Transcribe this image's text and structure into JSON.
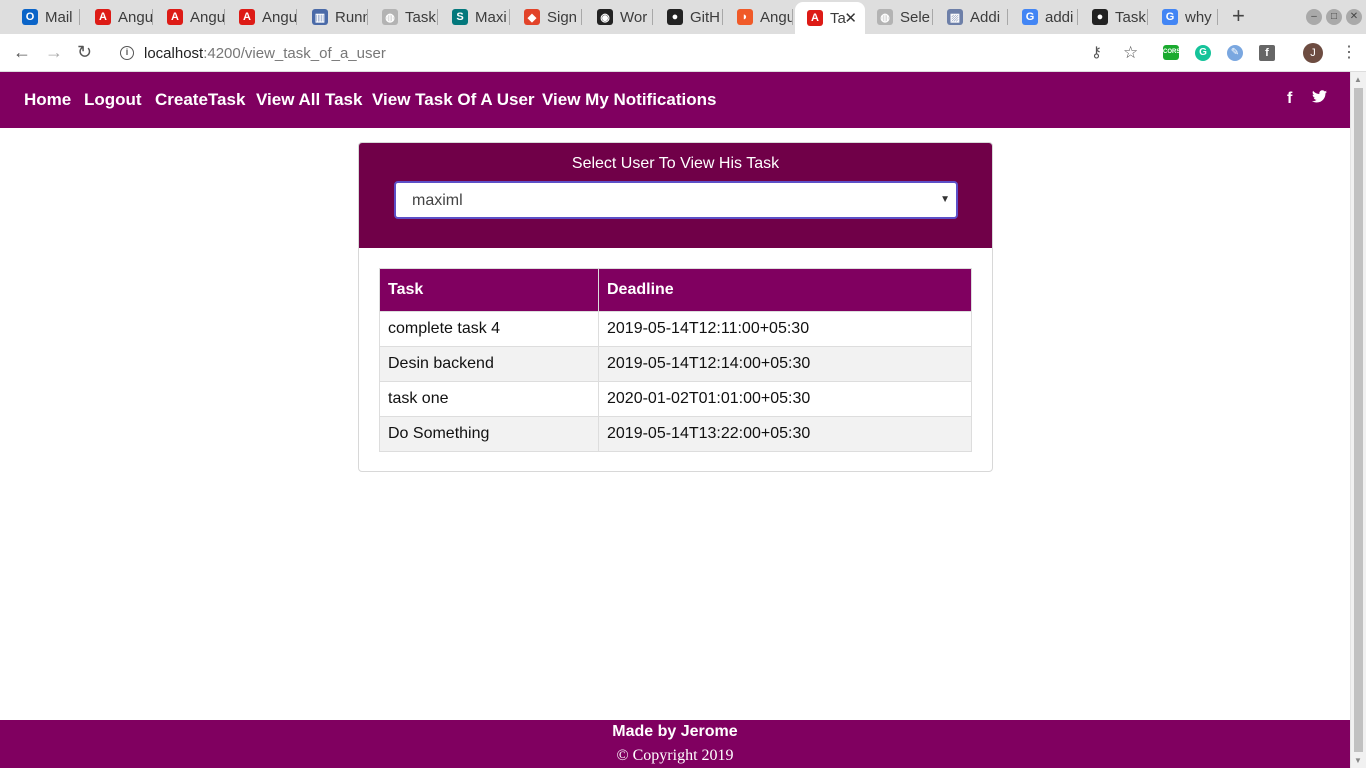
{
  "browser": {
    "tabs": [
      {
        "title": "Mail",
        "icon": "outlook-icon",
        "color": "#0a64c8",
        "glyph": "O"
      },
      {
        "title": "Angu",
        "icon": "angular-icon",
        "color": "#dd1b16",
        "glyph": "A"
      },
      {
        "title": "Angu",
        "icon": "angular-icon",
        "color": "#dd1b16",
        "glyph": "A"
      },
      {
        "title": "Angu",
        "icon": "angular-icon",
        "color": "#dd1b16",
        "glyph": "A"
      },
      {
        "title": "Runn",
        "icon": "document-icon",
        "color": "#4a6aa8",
        "glyph": "▥"
      },
      {
        "title": "Task",
        "icon": "globe-icon",
        "color": "#b3b3b3",
        "glyph": "◍"
      },
      {
        "title": "Maxi",
        "icon": "sharepoint-icon",
        "color": "#03787c",
        "glyph": "S"
      },
      {
        "title": "Sign",
        "icon": "gitlab-icon",
        "color": "#e24329",
        "glyph": "◆"
      },
      {
        "title": "Wor",
        "icon": "wordpress-icon",
        "color": "#222222",
        "glyph": "◉"
      },
      {
        "title": "GitH",
        "icon": "github-icon",
        "color": "#222222",
        "glyph": "●"
      },
      {
        "title": "Angu",
        "icon": "stackblitz-icon",
        "color": "#f05a28",
        "glyph": "◗"
      },
      {
        "title": "Ta",
        "icon": "angular-icon",
        "color": "#dd1b16",
        "glyph": "A",
        "active": true
      },
      {
        "title": "Sele",
        "icon": "globe-icon",
        "color": "#b3b3b3",
        "glyph": "◍"
      },
      {
        "title": "Addi",
        "icon": "image-icon",
        "color": "#6d7fa8",
        "glyph": "▨"
      },
      {
        "title": "addi",
        "icon": "google-icon",
        "color": "#4285f4",
        "glyph": "G"
      },
      {
        "title": "Task",
        "icon": "github-icon",
        "color": "#222222",
        "glyph": "●"
      },
      {
        "title": "why",
        "icon": "google-icon",
        "color": "#4285f4",
        "glyph": "G"
      }
    ],
    "url_host": "localhost",
    "url_path": ":4200/view_task_of_a_user",
    "profile_initial": "J",
    "cors_label": "CORS"
  },
  "nav": {
    "links": [
      "Home",
      "Logout",
      "CreateTask",
      "View All Task",
      "View Task Of A User",
      "View My Notifications"
    ],
    "facebook": "f",
    "twitter": "t"
  },
  "panel": {
    "title": "Select User To View His Task",
    "selected_user": "maximl"
  },
  "table": {
    "headers": [
      "Task",
      "Deadline"
    ],
    "rows": [
      [
        "complete task 4",
        "2019-05-14T12:11:00+05:30"
      ],
      [
        "Desin backend",
        "2019-05-14T12:14:00+05:30"
      ],
      [
        "task one",
        "2020-01-02T01:01:00+05:30"
      ],
      [
        "Do Something",
        "2019-05-14T13:22:00+05:30"
      ]
    ]
  },
  "footer": {
    "title": "Made by Jerome",
    "copyright": "© Copyright 2019"
  },
  "colors": {
    "brand": "#800060",
    "panel": "#700048",
    "select_border": "#5c4fc7"
  }
}
